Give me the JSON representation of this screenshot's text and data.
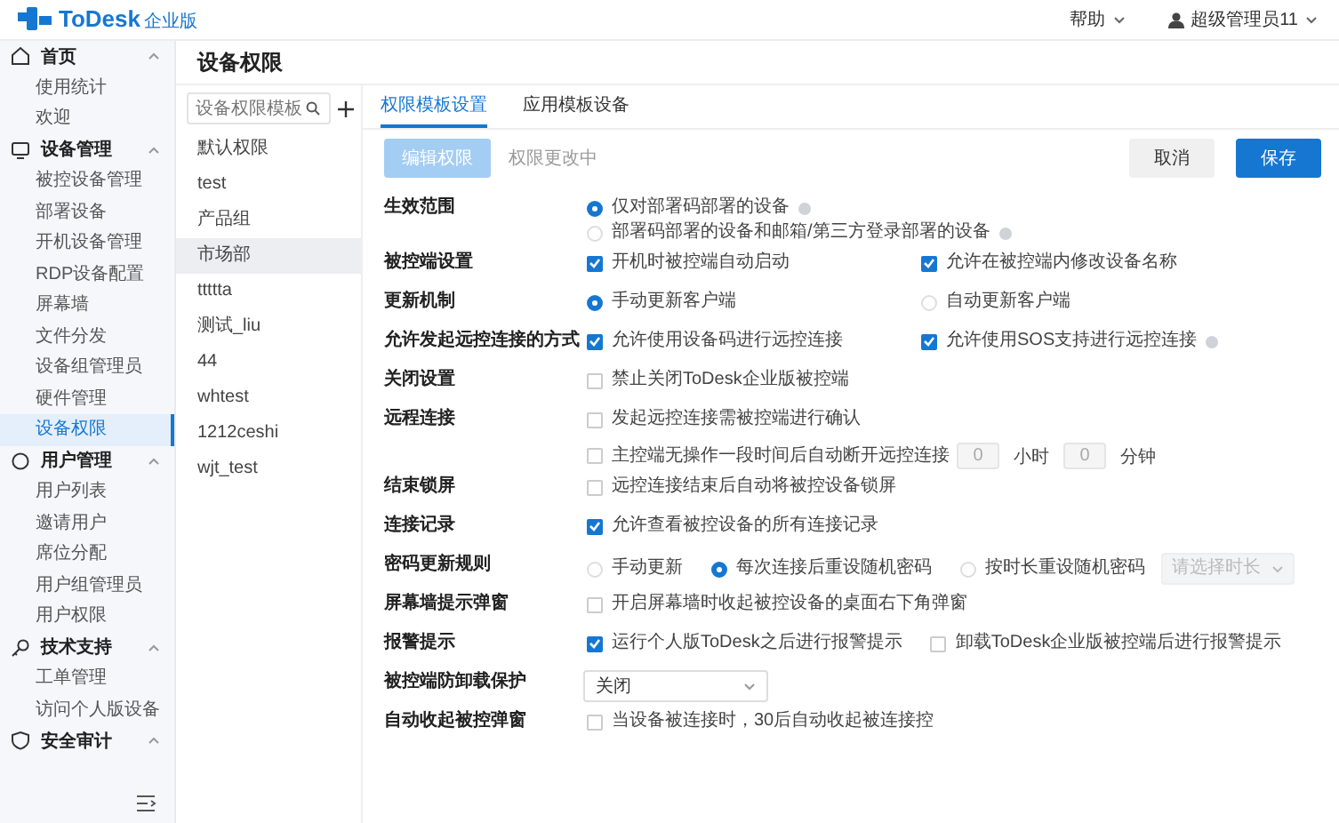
{
  "header": {
    "logo": "ToDesk",
    "logo_sub": "企业版",
    "help": "帮助",
    "user": "超级管理员11"
  },
  "sidebar": {
    "groups": [
      {
        "label": "首页",
        "expanded": true,
        "children": [
          {
            "label": "使用统计",
            "selected": false
          },
          {
            "label": "欢迎",
            "selected": false
          }
        ]
      },
      {
        "label": "设备管理",
        "expanded": true,
        "children": [
          {
            "label": "被控设备管理",
            "selected": false
          },
          {
            "label": "部署设备",
            "selected": false
          },
          {
            "label": "开机设备管理",
            "selected": false
          },
          {
            "label": "RDP设备配置",
            "selected": false
          },
          {
            "label": "屏幕墙",
            "selected": false
          },
          {
            "label": "文件分发",
            "selected": false
          },
          {
            "label": "设备组管理员",
            "selected": false
          },
          {
            "label": "硬件管理",
            "selected": false
          },
          {
            "label": "设备权限",
            "selected": true
          }
        ]
      },
      {
        "label": "用户管理",
        "expanded": true,
        "children": [
          {
            "label": "用户列表",
            "selected": false
          },
          {
            "label": "邀请用户",
            "selected": false
          },
          {
            "label": "席位分配",
            "selected": false
          },
          {
            "label": "用户组管理员",
            "selected": false
          },
          {
            "label": "用户权限",
            "selected": false
          }
        ]
      },
      {
        "label": "技术支持",
        "expanded": true,
        "children": [
          {
            "label": "工单管理",
            "selected": false
          },
          {
            "label": "访问个人版设备",
            "selected": false
          }
        ]
      },
      {
        "label": "安全审计",
        "expanded": true
      }
    ]
  },
  "page_title": "设备权限",
  "templates": {
    "search_placeholder": "设备权限模板",
    "items": [
      {
        "label": "默认权限",
        "selected": false
      },
      {
        "label": "test",
        "selected": false
      },
      {
        "label": "产品组",
        "selected": false
      },
      {
        "label": "市场部",
        "selected": true
      },
      {
        "label": "ttttta",
        "selected": false
      },
      {
        "label": "测试_liu",
        "selected": false
      },
      {
        "label": "44",
        "selected": false
      },
      {
        "label": "whtest",
        "selected": false
      },
      {
        "label": "1212ceshi",
        "selected": false
      },
      {
        "label": "wjt_test",
        "selected": false
      }
    ]
  },
  "tabs": [
    {
      "label": "权限模板设置",
      "selected": true
    },
    {
      "label": "应用模板设备",
      "selected": false
    }
  ],
  "toolbar": {
    "edit": {
      "label": "编辑权限",
      "disabled": true
    },
    "status": "权限更改中",
    "cancel": "取消",
    "save": "保存"
  },
  "rows": [
    {
      "label": "生效范围",
      "lines": [
        {
          "kind": "columns",
          "items": [
            {
              "kind": "radio",
              "text": "仅对部署码部署的设备",
              "selected": true,
              "help": true
            }
          ]
        },
        {
          "kind": "columns",
          "items": [
            {
              "kind": "radio",
              "text": "部署码部署的设备和邮箱/第三方登录部署的设备",
              "selected": false,
              "help": true
            }
          ]
        }
      ]
    },
    {
      "label": "被控端设置",
      "lines": [
        {
          "kind": "columns",
          "items": [
            {
              "kind": "checkbox",
              "text": "开机时被控端自动启动",
              "checked": true
            },
            {
              "kind": "checkbox",
              "text": "允许在被控端内修改设备名称",
              "checked": true
            }
          ]
        }
      ]
    },
    {
      "label": "更新机制",
      "lines": [
        {
          "kind": "columns",
          "items": [
            {
              "kind": "radio",
              "text": "手动更新客户端",
              "selected": true
            },
            {
              "kind": "radio",
              "text": "自动更新客户端",
              "selected": false
            }
          ]
        }
      ]
    },
    {
      "label": "允许发起远控连接的方式",
      "lines": [
        {
          "kind": "columns",
          "items": [
            {
              "kind": "checkbox",
              "text": "允许使用设备码进行远控连接",
              "checked": true
            },
            {
              "kind": "checkbox",
              "text": "允许使用SOS支持进行远控连接",
              "checked": true,
              "help": true
            }
          ]
        }
      ]
    },
    {
      "label": "关闭设置",
      "lines": [
        {
          "kind": "columns",
          "items": [
            {
              "kind": "checkbox",
              "text": "禁止关闭ToDesk企业版被控端",
              "checked": false
            }
          ]
        }
      ]
    },
    {
      "label": "远程连接",
      "lines": [
        {
          "kind": "columns",
          "items": [
            {
              "kind": "checkbox",
              "text": "发起远控连接需被控端进行确认",
              "checked": false
            }
          ]
        },
        {
          "kind": "inline",
          "items": [
            {
              "kind": "checkbox",
              "text": "主控端无操作一段时间后自动断开远控连接",
              "checked": false
            },
            {
              "kind": "number",
              "placeholder": "0"
            },
            {
              "kind": "text",
              "text": "小时"
            },
            {
              "kind": "number",
              "placeholder": "0"
            },
            {
              "kind": "text",
              "text": "分钟"
            }
          ]
        }
      ]
    },
    {
      "label": "结束锁屏",
      "lines": [
        {
          "kind": "columns",
          "items": [
            {
              "kind": "checkbox",
              "text": "远控连接结束后自动将被控设备锁屏",
              "checked": false
            }
          ]
        }
      ]
    },
    {
      "label": "连接记录",
      "lines": [
        {
          "kind": "columns",
          "items": [
            {
              "kind": "checkbox",
              "text": "允许查看被控设备的所有连接记录",
              "checked": true
            }
          ]
        }
      ]
    },
    {
      "label": "密码更新规则",
      "lines": [
        {
          "kind": "columns",
          "items": [
            {
              "kind": "radio",
              "text": "手动更新",
              "selected": false
            },
            {
              "kind": "radio",
              "text": "每次连接后重设随机密码",
              "selected": true
            },
            {
              "kind": "radio",
              "text": "按时长重设随机密码",
              "selected": false,
              "select": {
                "placeholder": "请选择时长",
                "disabled": true
              }
            }
          ]
        }
      ]
    },
    {
      "label": "屏幕墙提示弹窗",
      "lines": [
        {
          "kind": "columns",
          "items": [
            {
              "kind": "checkbox",
              "text": "开启屏幕墙时收起被控设备的桌面右下角弹窗",
              "checked": false
            }
          ]
        }
      ]
    },
    {
      "label": "报警提示",
      "lines": [
        {
          "kind": "columns",
          "items": [
            {
              "kind": "checkbox",
              "text": "运行个人版ToDesk之后进行报警提示",
              "checked": true
            },
            {
              "kind": "checkbox",
              "text": "卸载ToDesk企业版被控端后进行报警提示",
              "checked": false
            }
          ]
        }
      ]
    },
    {
      "label": "被控端防卸载保护",
      "lines": [
        {
          "kind": "columns",
          "items": [
            {
              "kind": "dropdown",
              "value": "关闭"
            }
          ]
        }
      ]
    },
    {
      "label": "自动收起被控弹窗",
      "lines": [
        {
          "kind": "columns",
          "items": [
            {
              "kind": "checkbox",
              "text": "当设备被连接时，30后自动收起被连接控",
              "checked": false
            }
          ]
        }
      ]
    }
  ]
}
